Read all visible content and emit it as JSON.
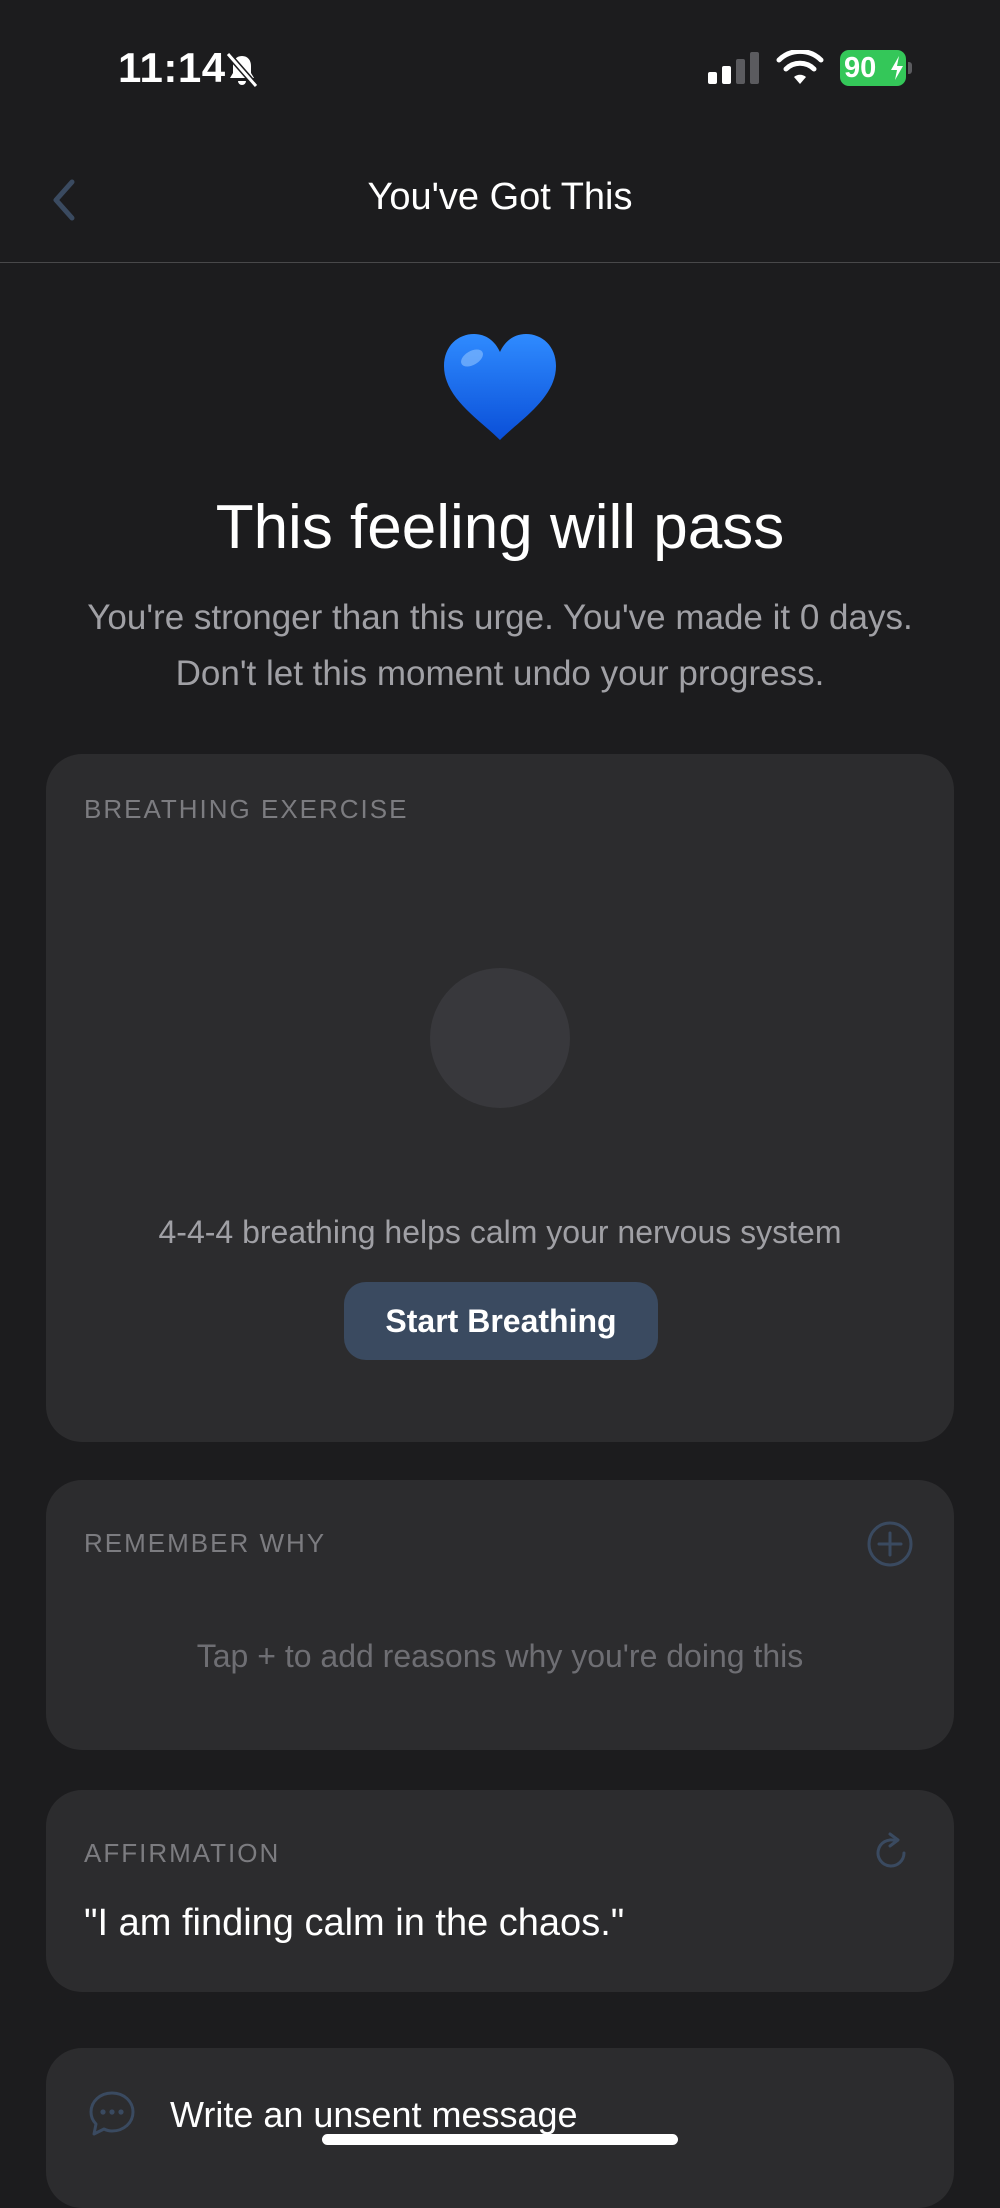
{
  "status_bar": {
    "time": "11:14",
    "battery": "90",
    "icons": [
      "bell-slash-icon",
      "signal-icon",
      "wifi-icon",
      "battery-charging-icon"
    ]
  },
  "nav": {
    "title": "You've Got This",
    "back_icon": "chevron-left-icon"
  },
  "hero": {
    "emoji": "blue-heart-icon",
    "headline": "This feeling will pass",
    "subtext_line1": "You're stronger than this urge. You've made it 0 days.",
    "subtext_line2": "Don't let this moment undo your progress."
  },
  "breathing": {
    "label": "BREATHING EXERCISE",
    "description": "4-4-4 breathing helps calm your nervous system",
    "button_label": "Start Breathing"
  },
  "remember_why": {
    "label": "REMEMBER WHY",
    "empty_text": "Tap + to add reasons why you're doing this",
    "add_icon": "plus-circle-icon"
  },
  "affirmation": {
    "label": "AFFIRMATION",
    "text": "\"I am finding calm in the chaos.\"",
    "refresh_icon": "refresh-icon"
  },
  "message": {
    "label": "Write an unsent message",
    "icon": "chat-bubble-icon"
  },
  "colors": {
    "background": "#1c1c1e",
    "card": "#2c2c2e",
    "accent": "#3a4a60",
    "battery": "#34c759"
  }
}
